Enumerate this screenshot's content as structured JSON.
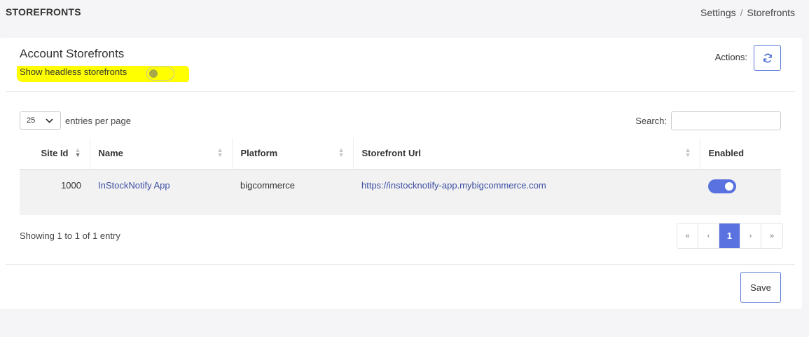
{
  "header": {
    "title": "STOREFRONTS",
    "breadcrumb": [
      "Settings",
      "Storefronts"
    ],
    "breadcrumb_separator": "/"
  },
  "card": {
    "title": "Account Storefronts",
    "headless_toggle": {
      "label": "Show headless storefronts",
      "enabled": false
    },
    "actions_label": "Actions:",
    "refresh_icon": "refresh-icon"
  },
  "table_controls": {
    "entries_value": "25",
    "entries_label": "entries per page",
    "search_label": "Search:",
    "search_value": ""
  },
  "table": {
    "columns": [
      "Site Id",
      "Name",
      "Platform",
      "Storefront Url",
      "Enabled"
    ],
    "rows": [
      {
        "site_id": "1000",
        "name": "InStockNotify App",
        "platform": "bigcommerce",
        "url": "https://instocknotify-app.mybigcommerce.com",
        "enabled": true
      }
    ]
  },
  "footer": {
    "showing": "Showing 1 to 1 of 1 entry",
    "pager": [
      "«",
      "‹",
      "1",
      "›",
      "»"
    ],
    "current_page": "1",
    "save_label": "Save"
  },
  "colors": {
    "accent": "#5a72e0",
    "highlight": "#ffff00",
    "link": "#3d4fa3"
  }
}
